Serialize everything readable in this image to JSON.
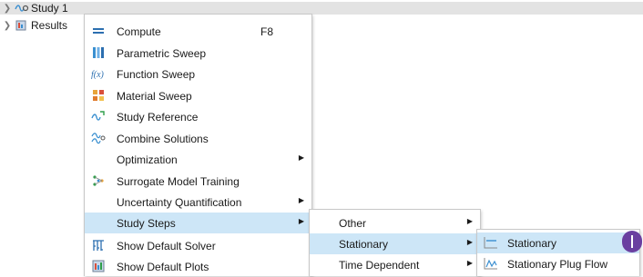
{
  "tree": {
    "study": {
      "label": "Study 1",
      "icon": "study-icon"
    },
    "results": {
      "label": "Results",
      "icon": "results-icon"
    }
  },
  "main_menu": {
    "items": [
      {
        "label": "Compute",
        "shortcut": "F8",
        "icon": "compute-icon"
      },
      {
        "label": "Parametric Sweep",
        "icon": "parametric-sweep-icon"
      },
      {
        "label": "Function Sweep",
        "icon": "function-sweep-icon"
      },
      {
        "label": "Material Sweep",
        "icon": "material-sweep-icon"
      },
      {
        "label": "Study Reference",
        "icon": "study-reference-icon"
      },
      {
        "label": "Combine Solutions",
        "icon": "combine-solutions-icon"
      },
      {
        "label": "Optimization",
        "has_submenu": true
      },
      {
        "label": "Surrogate Model Training",
        "icon": "surrogate-model-icon"
      },
      {
        "label": "Uncertainty Quantification",
        "has_submenu": true
      },
      {
        "label": "Study Steps",
        "has_submenu": true,
        "highlighted": true
      },
      {
        "label": "Show Default Solver",
        "icon": "default-solver-icon"
      },
      {
        "label": "Show Default Plots",
        "icon": "default-plots-icon"
      }
    ]
  },
  "study_steps_menu": {
    "items": [
      {
        "label": "Other",
        "has_submenu": true
      },
      {
        "label": "Stationary",
        "has_submenu": true,
        "highlighted": true
      },
      {
        "label": "Time Dependent",
        "has_submenu": true
      }
    ]
  },
  "stationary_menu": {
    "items": [
      {
        "label": "Stationary",
        "icon": "stationary-icon",
        "highlighted": true
      },
      {
        "label": "Stationary Plug Flow",
        "icon": "plug-flow-icon"
      }
    ]
  },
  "colors": {
    "highlight": "#cde6f7",
    "tree_selection": "#e3e3e3",
    "cursor_badge": "#6a3fa0"
  }
}
